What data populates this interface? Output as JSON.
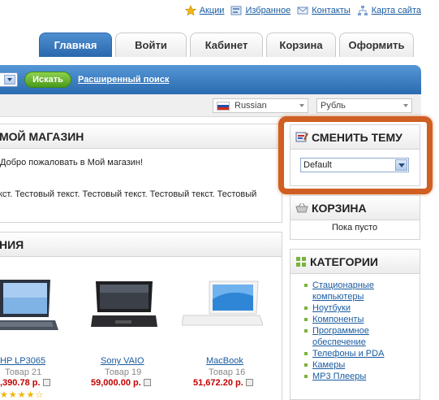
{
  "top_links": [
    {
      "label": "Акции",
      "icon": "star-icon"
    },
    {
      "label": "Избранное",
      "icon": "favorites-icon"
    },
    {
      "label": "Контакты",
      "icon": "contacts-icon"
    },
    {
      "label": "Карта сайта",
      "icon": "sitemap-icon"
    }
  ],
  "tabs": [
    {
      "label": "Главная",
      "active": true
    },
    {
      "label": "Войти"
    },
    {
      "label": "Кабинет"
    },
    {
      "label": "Корзина"
    },
    {
      "label": "Оформить"
    }
  ],
  "search": {
    "button_label": "Искать",
    "advanced_label": "Расширенный поиск"
  },
  "language_select": {
    "value": "Russian"
  },
  "currency_select": {
    "value": "Рубль"
  },
  "main_box": {
    "title": "МОЙ МАГАЗИН",
    "welcome": "Добро пожаловать в Мой магазин!",
    "body_text": "кст. Тестовый текст. Тестовый текст. Тестовый текст. Тестовый"
  },
  "new_box": {
    "title": "НИЯ"
  },
  "products": [
    {
      "name": "HP LP3065",
      "code": "Товар 21",
      "price": ",390.78 р."
    },
    {
      "name": "Sony VAIO",
      "code": "Товар 19",
      "price": "59,000.00 р."
    },
    {
      "name": "MacBook",
      "code": "Товар 16",
      "price": "51,672.20 р."
    }
  ],
  "theme_box": {
    "title": "СМЕНИТЬ ТЕМУ",
    "selected": "Default"
  },
  "cart_box": {
    "title": "КОРЗИНА",
    "status": "Пока пусто"
  },
  "categories_box": {
    "title": "КАТЕГОРИИ",
    "items": [
      "Стационарные компьютеры",
      "Ноутбуки",
      "Компоненты",
      "Программное обеспечение",
      "Телефоны и PDA",
      "Камеры",
      "MP3 Плееры"
    ]
  },
  "colors": {
    "accent_blue": "#2a6bb0",
    "search_green": "#4b9a1b",
    "highlight_orange": "#cf5f22",
    "price_red": "#c00000",
    "link_blue": "#1a5ba0"
  }
}
